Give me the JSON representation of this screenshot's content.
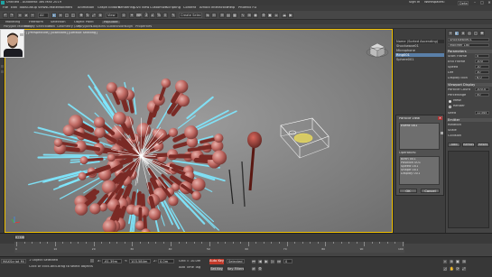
{
  "title_bar": {
    "title": "Untitled - Autodesk 3ds Max 2019",
    "sign_in": "Sign In",
    "workspace_label": "Workspaces:",
    "workspace_value": "Default",
    "minimize": "–",
    "maximize": "□",
    "close": "✕"
  },
  "menu": [
    "File",
    "Edit",
    "Tools",
    "Group",
    "Views",
    "Create",
    "Modifiers",
    "Animation",
    "Graph Editors",
    "Rendering",
    "Civil View",
    "Customize",
    "Scripting",
    "Content",
    "Arnold",
    "Interactive",
    "Help",
    "Phoenix FD"
  ],
  "toolbar": {
    "selection_filter": "All",
    "view_dropdown": "View",
    "named_selection": "Create Selection Se"
  },
  "ribbon_tabs": [
    "Modeling",
    "Freeform",
    "Selection",
    "Object Paint",
    "Populate"
  ],
  "ribbon_selected": "Populate",
  "sub_ribbon": [
    "Polygon Modeling",
    "Modify Selection",
    "Edit",
    "Geometry (All)",
    "Polygons",
    "Loops",
    "Tris",
    "Subdivision",
    "Align",
    "Properties"
  ],
  "viewport": {
    "label": "[+] [Perspective] [Standard] [Default Shading]",
    "accent": "#f0c000"
  },
  "explorer": {
    "header": "Name (Sorted Ascending)",
    "rows": [
      "Shockwave01",
      "Microphone",
      "Ring001",
      "Sphere001"
    ],
    "selected_index": 2
  },
  "command_panel": {
    "section_title": "Shockwave01",
    "modifier_list": "Modifier List",
    "lines": [
      "Parameters",
      "Start Frame",
      "End Frame",
      "Speed",
      "Life",
      "Display Icon",
      "Viewport Display",
      "Particle Count",
      "Percentage",
      "Mesh",
      "Render",
      "Seed",
      "Emitter",
      "Rotation",
      "Scale",
      "Collision"
    ],
    "values": [
      "0",
      "100",
      "10",
      "30",
      "6.0",
      "100.0",
      "50",
      "12345"
    ],
    "buttons": [
      "Add",
      "Remove",
      "Reset"
    ]
  },
  "dialog": {
    "title": "Particle View",
    "box_label": "Event 001",
    "list_label": "Operators:",
    "list_items": [
      "Birth 001",
      "Position 001",
      "Speed 001",
      "Shape 001",
      "Display 001"
    ],
    "btn_ok": "OK",
    "btn_cancel": "Cancel"
  },
  "timeline": {
    "frame": "0 / 100",
    "ticks": [
      "0",
      "10",
      "20",
      "30",
      "40",
      "50",
      "60",
      "70",
      "80",
      "90",
      "100"
    ]
  },
  "status": {
    "selection": "1 Object Selected",
    "prompt": "Click or click-and-drag to select objects",
    "maxscript": "MAXScript Mi",
    "x_label": "X:",
    "x_value": "-61.39m",
    "y_label": "Y:",
    "y_value": "103.584m",
    "z_label": "Z:",
    "z_value": "0.0m",
    "grid": "Grid = 10.0m",
    "add_time_tag": "Add Time Tag",
    "auto_key": "Auto Key",
    "set_key": "Set Key",
    "selected": "Selected",
    "key_filters": "Key Filters...",
    "frame_field": "0"
  }
}
